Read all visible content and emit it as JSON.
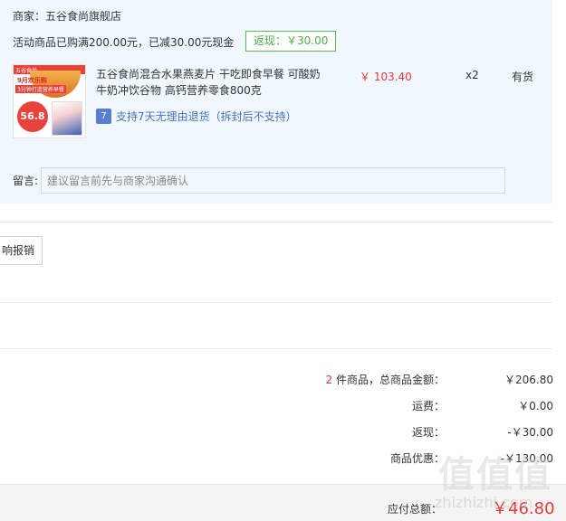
{
  "order": {
    "merchant_label": "商家：五谷食尚旗舰店",
    "promo_text": "活动商品已购满200.00元，已减30.00元现金",
    "rebate_badge": "返现：￥30.00",
    "product": {
      "title": "五谷食尚混合水果燕麦片 干吃即食早餐 可酸奶牛奶冲饮谷物 高钙营养零食800克",
      "price": "￥ 103.40",
      "quantity": "x2",
      "stock_status": "有货",
      "return_icon_text": "7",
      "return_policy": "支持7天无理由退货（拆封后不支持）",
      "thumbnail": {
        "top_text": "五谷食尚",
        "line1": "9月欢乐购",
        "line2": "3分钟打造营养早餐",
        "circle_text": "56.8"
      }
    },
    "message_label": "留言:",
    "message_placeholder": "建议留言前先与商家沟通确认"
  },
  "invoice": {
    "button_label": "响报销"
  },
  "summary": {
    "count_number": "2",
    "count_suffix": " 件商品，总商品金额：",
    "goods_total": "￥206.80",
    "shipping_label": "运费：",
    "shipping_value": "￥0.00",
    "rebate_label": "返现：",
    "rebate_value": "-￥30.00",
    "discount_label": "商品优惠：",
    "discount_value": "-￥130.00"
  },
  "total": {
    "label": "应付总额：",
    "value": "￥46.80"
  },
  "watermark": {
    "glyphs": "值值值",
    "text": "zhizhizhi.com"
  },
  "colors": {
    "panel_bg": "#f0f8fd",
    "price_red": "#e4393c",
    "badge_green": "#4cae4c",
    "link_blue": "#4a70c8"
  }
}
